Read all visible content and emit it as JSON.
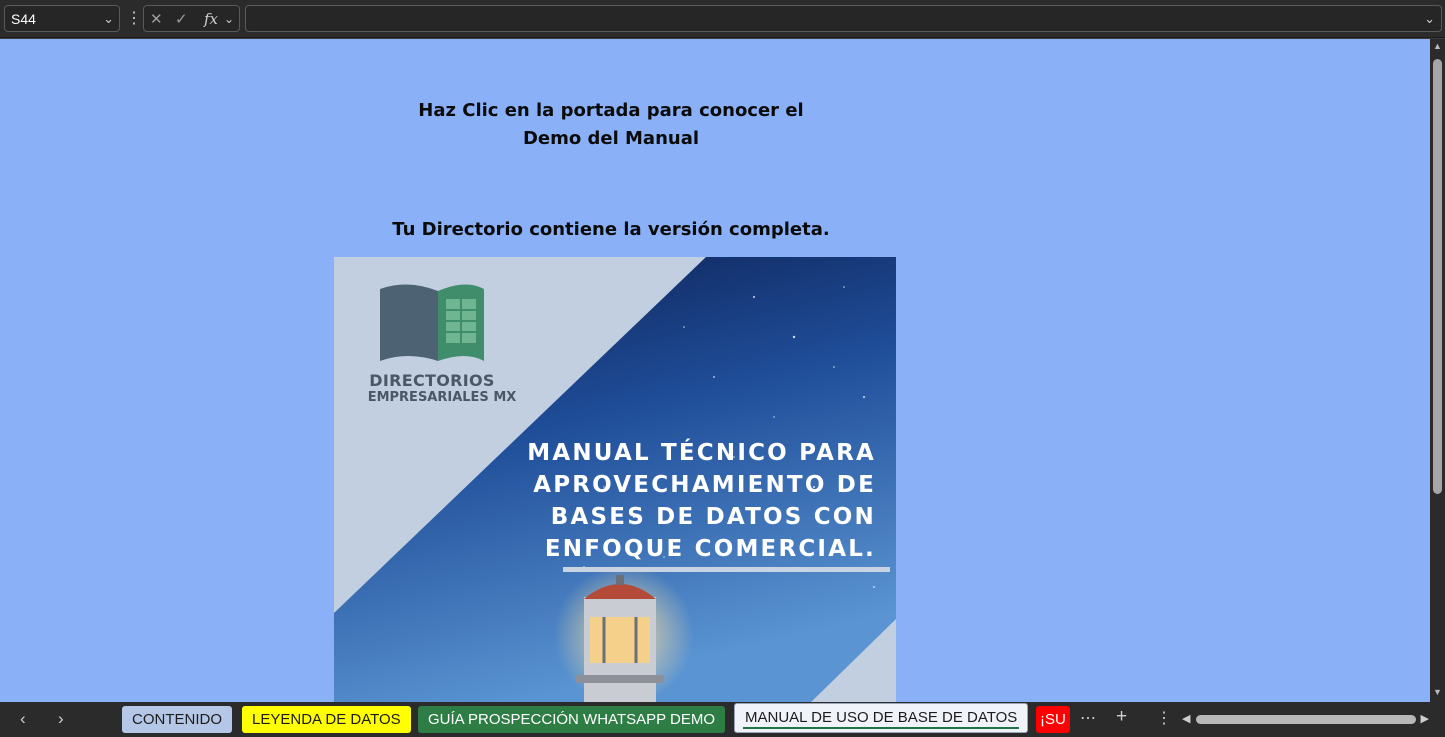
{
  "formula_bar": {
    "cell_reference": "S44",
    "formula_value": ""
  },
  "sheet": {
    "background_color": "#8ab1f8",
    "instruction_line1": "Haz Clic en la portada para conocer el",
    "instruction_line2": "Demo del Manual",
    "note": "Tu Directorio contiene la versión completa."
  },
  "cover": {
    "logo_line1": "DIRECTORIOS",
    "logo_line2": "EMPRESARIALES MX",
    "title_lines": [
      "MANUAL TÉCNICO PARA",
      "APROVECHAMIENTO DE",
      "BASES DE DATOS CON",
      "ENFOQUE COMERCIAL."
    ]
  },
  "tabs": [
    {
      "label": "CONTENIDO",
      "bg": "#b4c7e7",
      "color": "#1c1c1c"
    },
    {
      "label": "LEYENDA DE DATOS",
      "bg": "#ffff00",
      "color": "#1c1c1c"
    },
    {
      "label": "GUÍA PROSPECCIÓN WHATSAPP DEMO",
      "bg": "#2e7d45",
      "color": "#ffffff"
    },
    {
      "label": "MANUAL DE USO DE BASE DE DATOS",
      "bg": "#f0f3fa",
      "color": "#1c1c1c",
      "active": true
    },
    {
      "label": "¡SU",
      "bg": "#ff0000",
      "color": "#ffffff"
    }
  ],
  "icons": {
    "chevron": "chevron-down-icon",
    "cancel": "x-icon",
    "confirm": "check-icon",
    "function": "fx-icon"
  }
}
